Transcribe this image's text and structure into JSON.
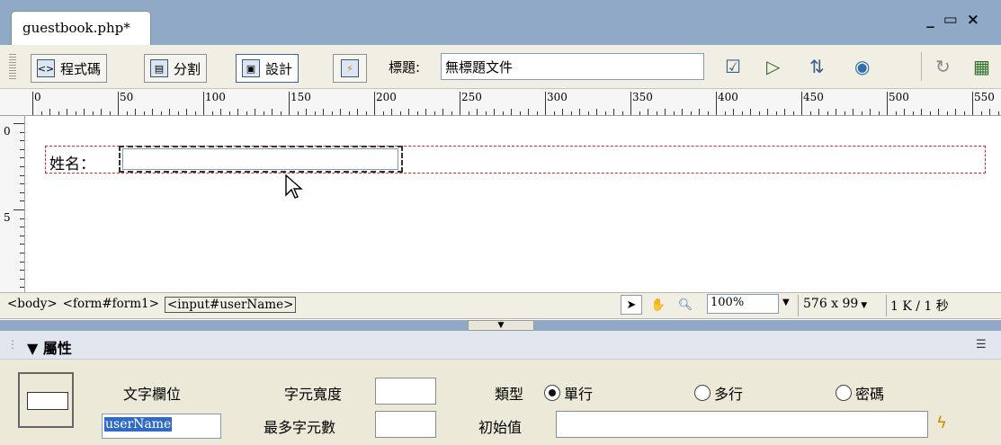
{
  "document": {
    "tab_title": "guestbook.php*"
  },
  "window_controls": {
    "minimize": "_",
    "restore": "▭",
    "close": "×"
  },
  "toolbar": {
    "code_label": "程式碼",
    "split_label": "分割",
    "design_label": "設計",
    "title_label": "標題:",
    "title_value": "無標題文件"
  },
  "ruler": {
    "top_labels": [
      "0",
      "50",
      "100",
      "150",
      "200",
      "250",
      "300",
      "350",
      "400",
      "450",
      "500",
      "550"
    ],
    "left_labels": [
      "0",
      "5"
    ]
  },
  "canvas": {
    "name_label": "姓名："
  },
  "status": {
    "tag_body": "<body>",
    "tag_form": "<form#form1>",
    "tag_input": "<input#userName>",
    "zoom": "100%",
    "window_size": "576 x 99",
    "download": "1 K / 1 秒"
  },
  "properties": {
    "header": "屬性",
    "field_type_label": "文字欄位",
    "field_id": "userName",
    "char_width_label": "字元寬度",
    "max_chars_label": "最多字元數",
    "type_label": "類型",
    "type_options": [
      "單行",
      "多行",
      "密碼"
    ],
    "type_selected": "單行",
    "init_value_label": "初始值"
  }
}
